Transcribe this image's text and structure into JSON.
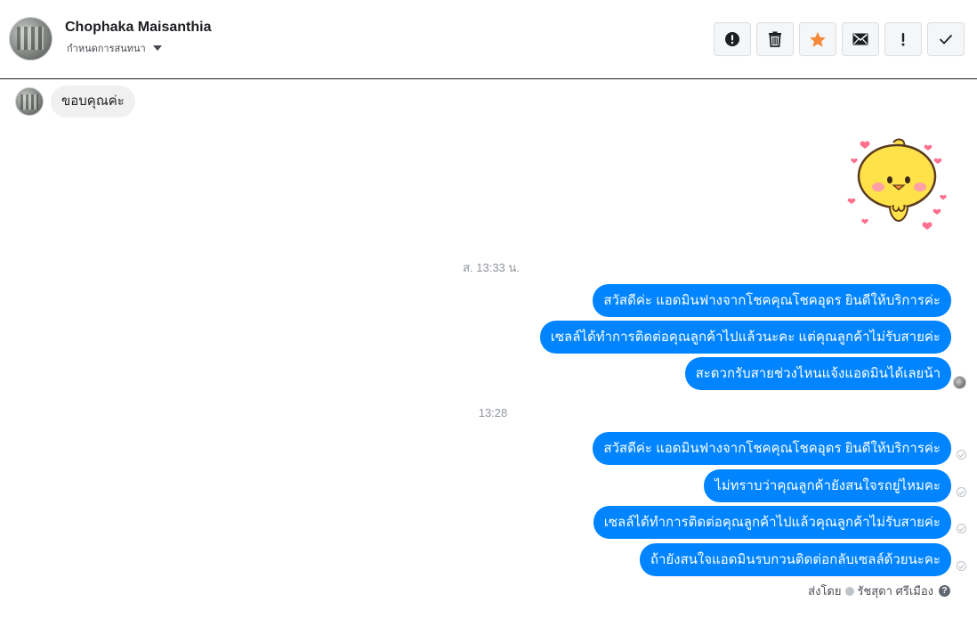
{
  "header": {
    "contact_name": "Chophaka Maisanthia",
    "assign_label": "กำหนดการสนทนา",
    "actions": [
      {
        "name": "spam-report",
        "icon": "alert-circle-icon"
      },
      {
        "name": "delete",
        "icon": "trash-icon"
      },
      {
        "name": "star",
        "icon": "star-icon",
        "color": "#f6883a"
      },
      {
        "name": "mark-unread",
        "icon": "envelope-icon"
      },
      {
        "name": "follow-up",
        "icon": "exclamation-icon"
      },
      {
        "name": "mark-done",
        "icon": "checkmark-icon"
      }
    ]
  },
  "incoming": {
    "message": "ขอบคุณค่ะ"
  },
  "sticker": {
    "icon": "chick-sticker-with-hearts"
  },
  "timestamps": {
    "first": "ส. 13:33 น.",
    "second": "13:28"
  },
  "outgoing_group_1": [
    "สวัสดีค่ะ แอดมินฟางจากโชคคุณโชคอุดร ยินดีให้บริการค่ะ",
    "เซลล์ได้ทำการติดต่อคุณลูกค้าไปแล้วนะคะ  แต่คุณลูกค้าไม่รับสายค่ะ",
    "สะดวกรับสายช่วงไหนแจ้งแอดมินได้เลยน้า"
  ],
  "outgoing_group_2": [
    "สวัสดีค่ะ แอดมินฟางจากโชคคุณโชคอุดร ยินดีให้บริการค่ะ",
    "ไม่ทราบว่าคุณลูกค้ายังสนใจรถยู่ไหมคะ",
    "เซลล์ได้ทำการติดต่อคุณลูกค้าไปแล้วคุณลูกค้าไม่รับสายค่ะ",
    "ถ้ายังสนใจแอดมินรบกวนติดต่อกลับเซลล์ด้วยนะคะ"
  ],
  "sent_by": {
    "prefix": "ส่งโดย",
    "agent": "รัชสุดา ศรีเมือง"
  },
  "colors": {
    "outgoing_bubble": "#0084ff",
    "incoming_bubble": "#f1f0f0",
    "star": "#f6883a"
  }
}
